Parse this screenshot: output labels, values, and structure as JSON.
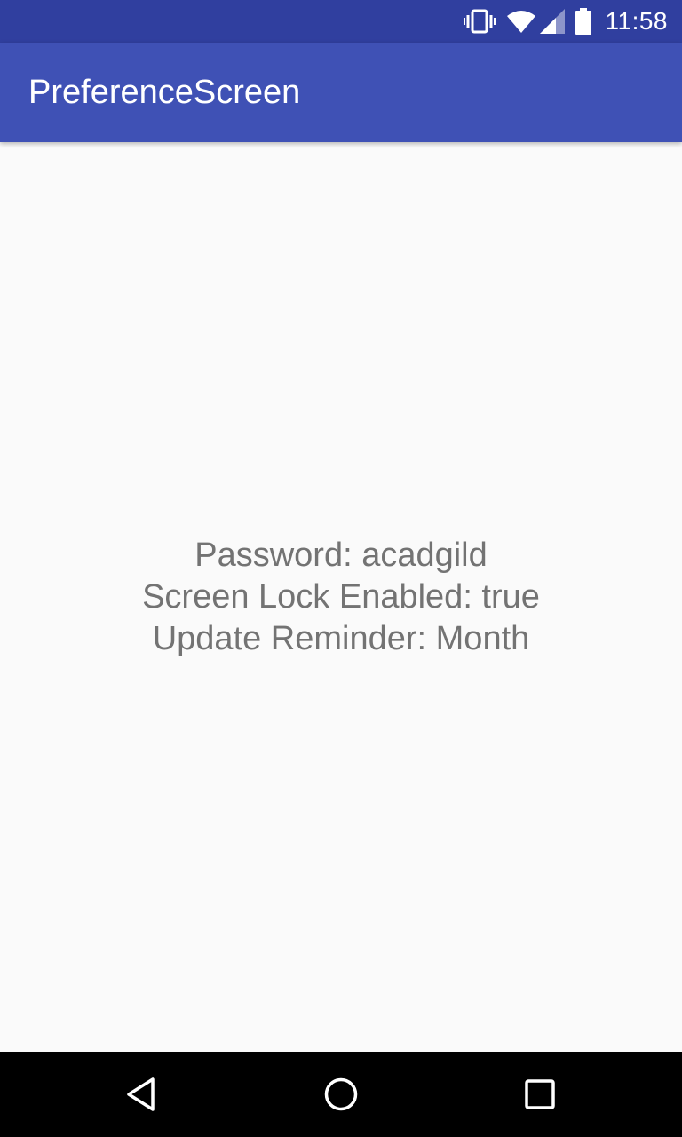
{
  "status_bar": {
    "time": "11:58",
    "icons": [
      "vibrate-icon",
      "wifi-icon",
      "signal-icon",
      "battery-icon"
    ]
  },
  "app_bar": {
    "title": "PreferenceScreen",
    "background": "#3f51b5",
    "status_background": "#303f9f"
  },
  "content": {
    "lines": [
      "Password: acadgild",
      "Screen Lock Enabled: true",
      "Update Reminder: Month"
    ]
  },
  "nav_bar": {
    "buttons": [
      "back-icon",
      "home-icon",
      "recents-icon"
    ]
  }
}
